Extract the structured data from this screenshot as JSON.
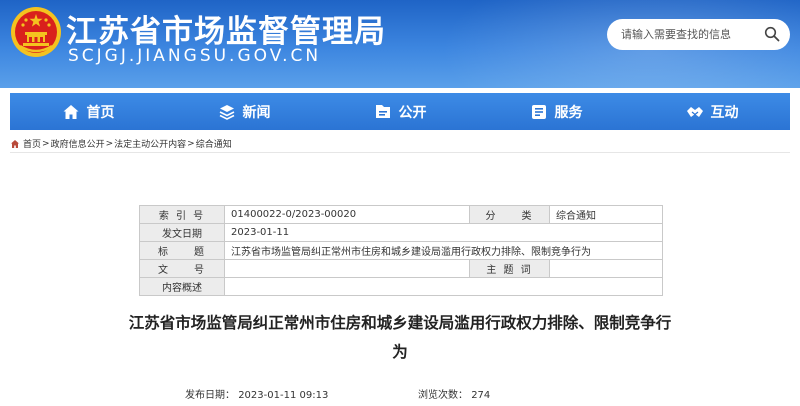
{
  "header": {
    "site_title": "江苏省市场监督管理局",
    "site_domain": "SCJGJ.JIANGSU.GOV.CN",
    "emblem": "national-emblem",
    "search_placeholder": "请输入需要查找的信息",
    "colors": {
      "header_blue": "#2b74d4",
      "emblem_red": "#d9201c",
      "emblem_gold": "#f4c21f"
    }
  },
  "nav": {
    "items": [
      {
        "label": "首页",
        "icon": "home-icon"
      },
      {
        "label": "新闻",
        "icon": "news-icon"
      },
      {
        "label": "公开",
        "icon": "disclosure-icon"
      },
      {
        "label": "服务",
        "icon": "service-icon"
      },
      {
        "label": "互动",
        "icon": "interaction-icon"
      }
    ]
  },
  "breadcrumb": {
    "items": [
      "首页",
      "政府信息公开",
      "法定主动公开内容",
      "综合通知"
    ],
    "separator": ">"
  },
  "meta": {
    "index_label": "索 引 号",
    "index_value": "01400022-0/2023-00020",
    "category_label": "分　　类",
    "category_value": "综合通知",
    "date_label": "发文日期",
    "date_value": "2023-01-11",
    "title_label": "标　　题",
    "title_value": "江苏省市场监管局纠正常州市住房和城乡建设局滥用行政权力排除、限制竞争行为",
    "docno_label": "文　　号",
    "docno_value": "",
    "subject_label": "主 题 词",
    "subject_value": "",
    "summary_label": "内容概述",
    "summary_value": ""
  },
  "article": {
    "title_line1": "江苏省市场监管局纠正常州市住房和城乡建设局滥用行政权力排除、限制竞争行",
    "title_line2": "为",
    "publish_label": "发布日期：",
    "publish_time": "2023-01-11 09:13",
    "views_label": "浏览次数：",
    "views_value": "274"
  }
}
